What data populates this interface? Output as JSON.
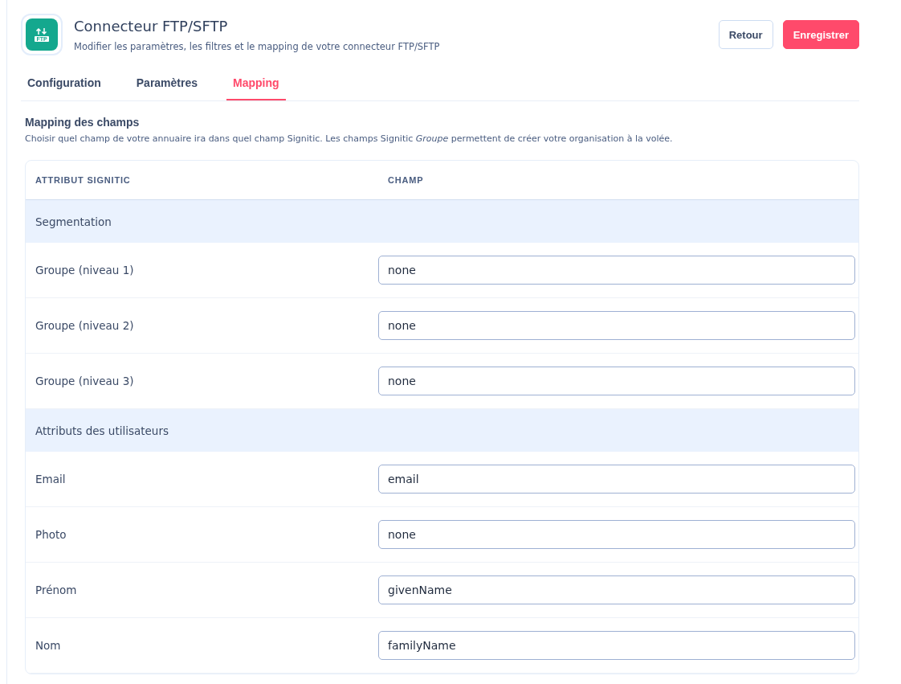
{
  "header": {
    "title": "Connecteur FTP/SFTP",
    "subtitle": "Modifier les paramètres, les filtres et le mapping de votre connecteur FTP/SFTP",
    "icon_label": "FTP"
  },
  "buttons": [
    {
      "label": "Retour",
      "kind": "secondary"
    },
    {
      "label": "Enregistrer",
      "kind": "primary"
    }
  ],
  "tabs": [
    {
      "label": "Configuration",
      "selected": false
    },
    {
      "label": "Paramètres",
      "selected": false
    },
    {
      "label": "Mapping",
      "selected": true
    }
  ],
  "section": {
    "title": "Mapping des champs",
    "description": "Choisir quel champ de votre annuaire ira dans quel champ Signitic. Les champs Signitic *Groupe* permettent de créer votre organisation à la volée."
  },
  "table": {
    "columns": [
      "ATTRIBUT SIGNITIC",
      "CHAMP"
    ],
    "rows": [
      {
        "kind": "section",
        "label": "Segmentation"
      },
      {
        "kind": "field",
        "label": "Groupe (niveau 1)",
        "value": "none"
      },
      {
        "kind": "field",
        "label": "Groupe (niveau 2)",
        "value": "none"
      },
      {
        "kind": "field",
        "label": "Groupe (niveau 3)",
        "value": "none"
      },
      {
        "kind": "section",
        "label": "Attributs des utilisateurs"
      },
      {
        "kind": "field",
        "label": "Email",
        "value": "email"
      },
      {
        "kind": "field",
        "label": "Photo",
        "value": "none"
      },
      {
        "kind": "field",
        "label": "Prénom",
        "value": "givenName"
      },
      {
        "kind": "field",
        "label": "Nom",
        "value": "familyName"
      }
    ]
  }
}
